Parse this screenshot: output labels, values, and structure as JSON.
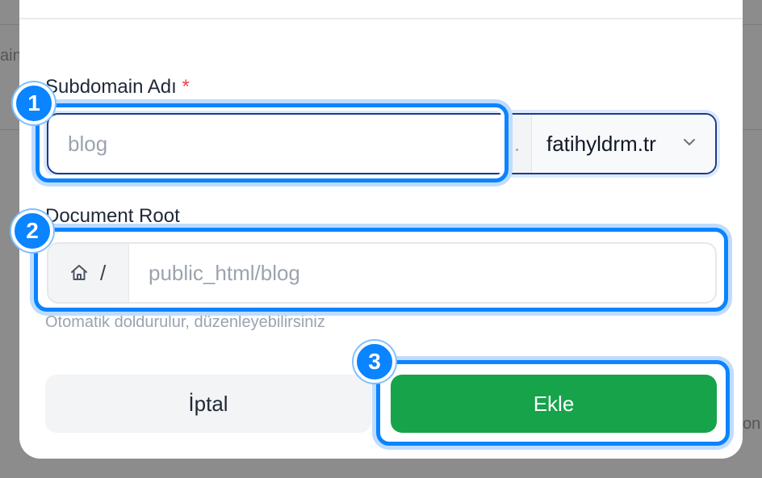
{
  "background": {
    "left_fragment": "ain",
    "right_fragment": "on"
  },
  "form": {
    "subdomain": {
      "label": "Subdomain Adı",
      "required_mark": "*",
      "placeholder": "blog",
      "separator": ".",
      "domain_selected": "fatihyldrm.tr"
    },
    "document_root": {
      "label": "Document Root",
      "prefix_separator": "/",
      "placeholder": "public_html/blog",
      "hint": "Otomatik doldurulur, düzenleyebilirsiniz"
    },
    "buttons": {
      "cancel_label": "İptal",
      "add_label": "Ekle"
    }
  },
  "annotations": {
    "badge_1": "1",
    "badge_2": "2",
    "badge_3": "3",
    "accent_color": "#0a84ff"
  },
  "colors": {
    "add_button": "#16a34a",
    "required": "#ef4444"
  }
}
